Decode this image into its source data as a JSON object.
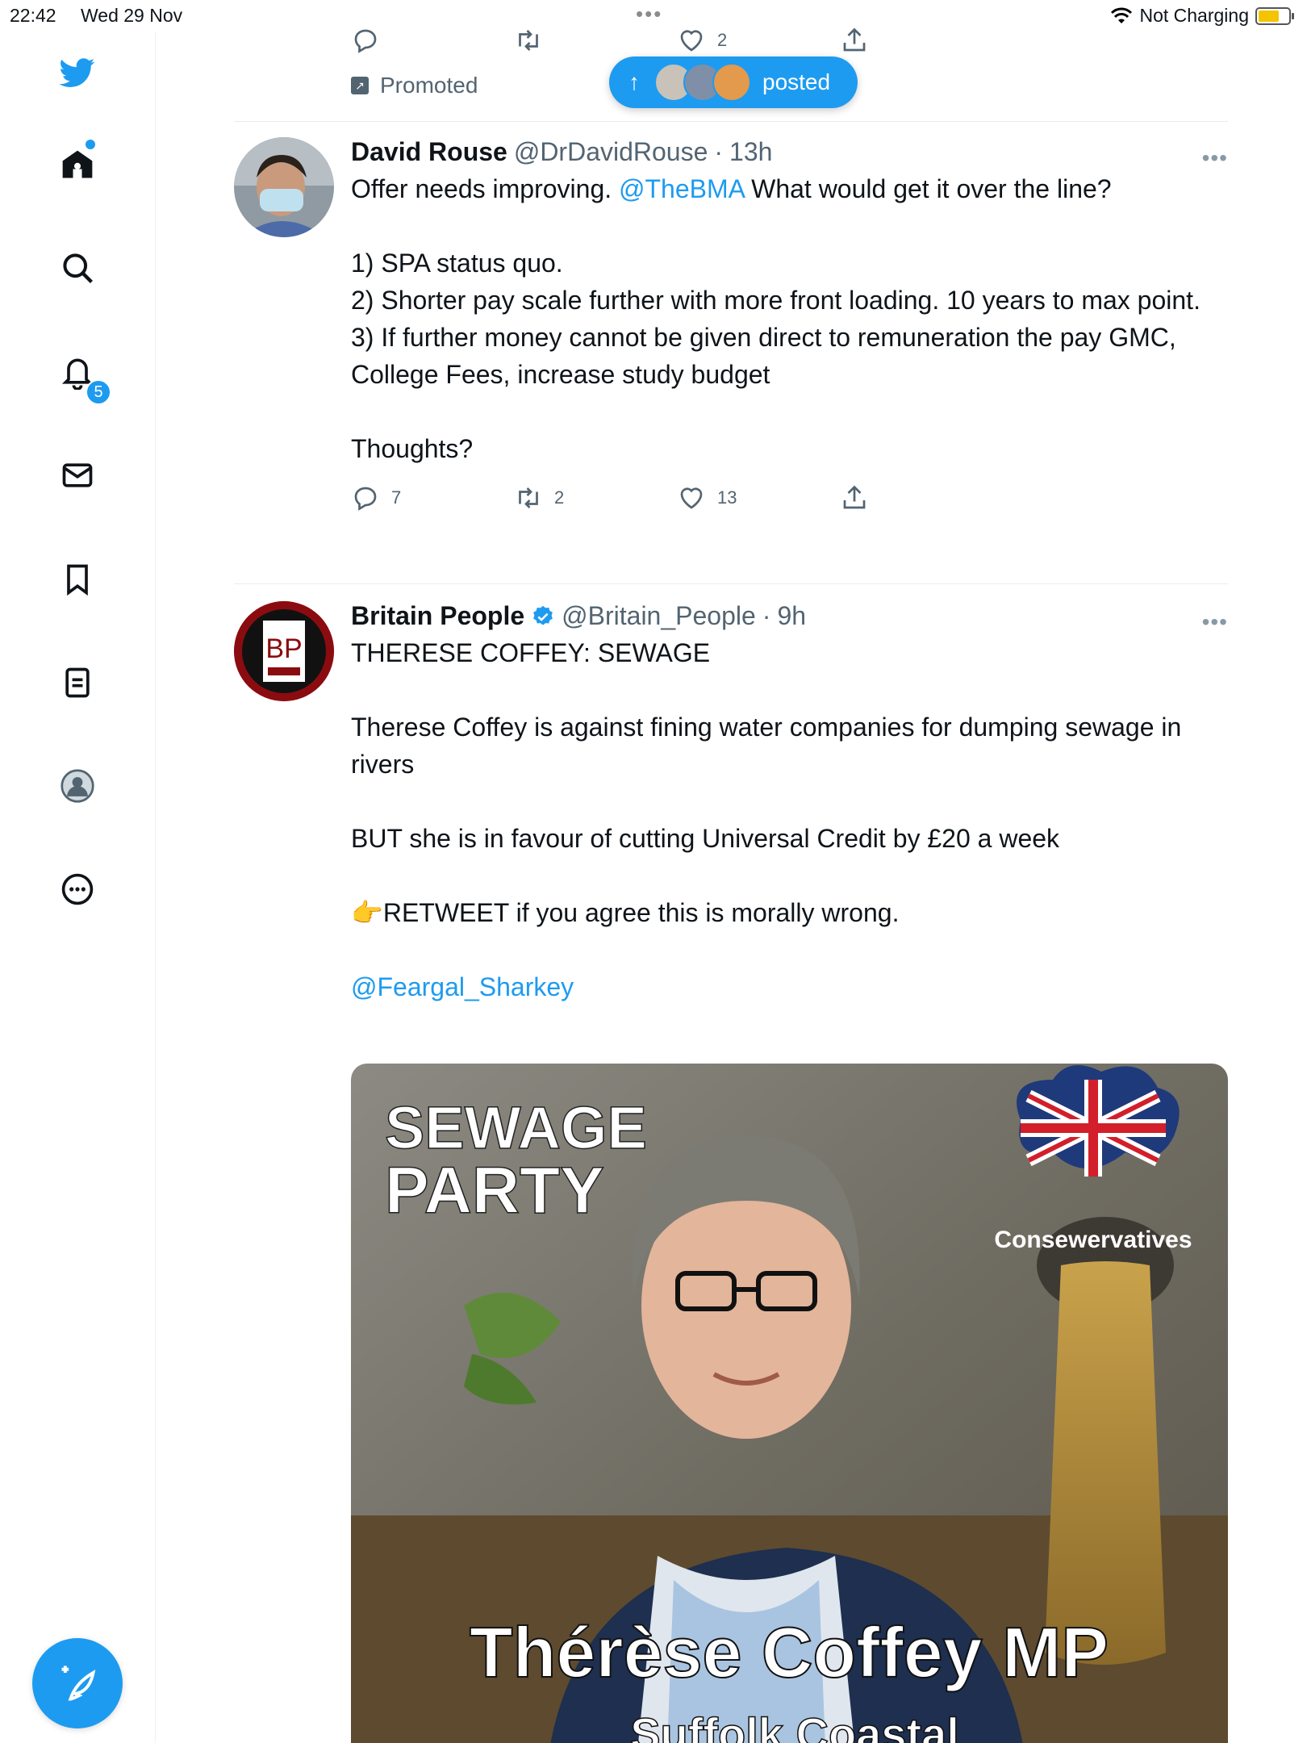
{
  "status_bar": {
    "time": "22:42",
    "date": "Wed 29 Nov",
    "charging": "Not Charging"
  },
  "sidebar": {
    "notifications_badge": "5"
  },
  "top_tweet": {
    "likes": "2",
    "promoted_label": "Promoted"
  },
  "new_posts_pill": {
    "label": "posted"
  },
  "tweets": [
    {
      "name": "David Rouse",
      "handle": "@DrDavidRouse",
      "time": "13h",
      "lines": [
        {
          "pre": "Offer needs improving. ",
          "mention": "@TheBMA",
          "post": " What would get it over the line?"
        },
        {
          "text": ""
        },
        {
          "text": "1) SPA status quo."
        },
        {
          "text": "2) Shorter pay scale further with more front loading. 10 years to max point."
        },
        {
          "text": "3) If further money cannot be given direct to remuneration the pay GMC, College Fees, increase study budget"
        },
        {
          "text": ""
        },
        {
          "text": "Thoughts?"
        }
      ],
      "replies": "7",
      "retweets": "2",
      "likes": "13"
    },
    {
      "name": "Britain People",
      "handle": "@Britain_People",
      "time": "9h",
      "verified": true,
      "avatar_text": "BP",
      "lines": [
        {
          "text": "THERESE COFFEY:  SEWAGE"
        },
        {
          "text": ""
        },
        {
          "text": "Therese Coffey is against fining water companies for dumping sewage in rivers"
        },
        {
          "text": ""
        },
        {
          "text": "BUT she is in favour of cutting Universal Credit by £20 a week"
        },
        {
          "text": ""
        },
        {
          "text": "👉RETWEET if you agree this is morally wrong."
        },
        {
          "text": ""
        },
        {
          "mention": "@Feargal_Sharkey"
        }
      ],
      "image": {
        "headline_1": "SEWAGE",
        "headline_2": "PARTY",
        "party_label": "Consewervatives",
        "person_name": "Thérèse Coffey MP",
        "constituency": "Suffolk Coastal"
      }
    }
  ],
  "colors": {
    "accent": "#1d9bf0",
    "text_primary": "#0f1419",
    "text_secondary": "#536471"
  }
}
